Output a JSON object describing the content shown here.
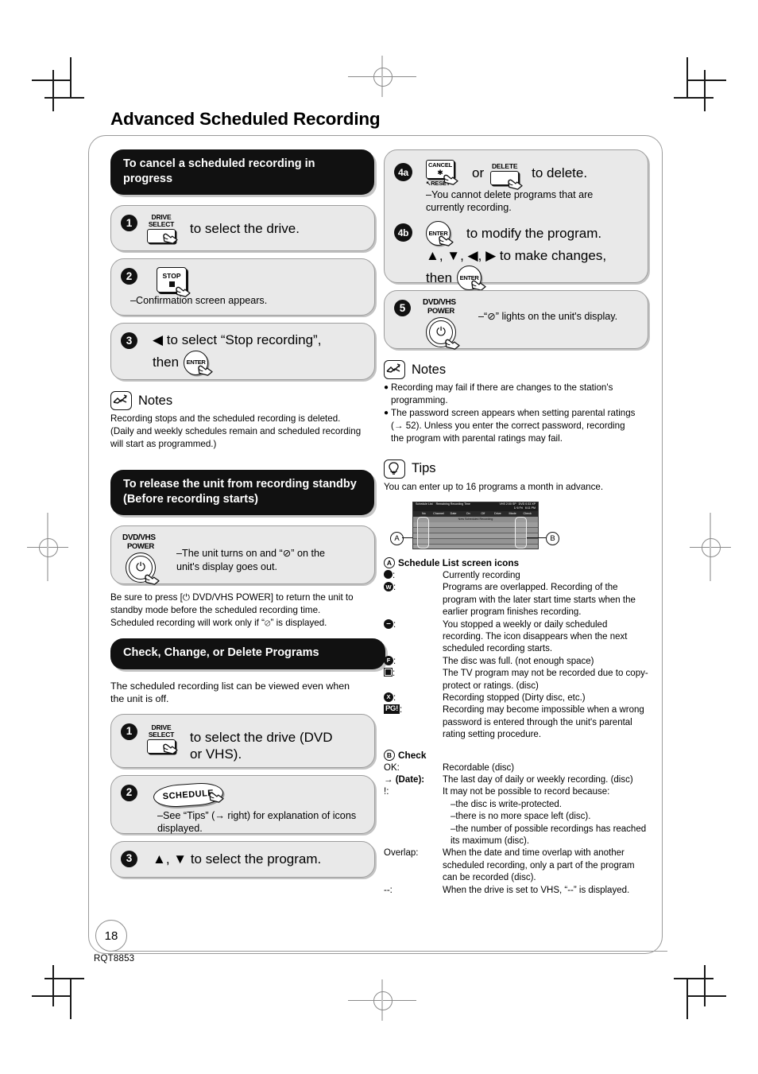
{
  "page": {
    "title": "Advanced Scheduled Recording",
    "number": "18",
    "doc_code": "RQT8853"
  },
  "left": {
    "section1": {
      "banner": "To cancel a scheduled recording in progress",
      "steps": [
        {
          "num": "1",
          "key_label_top": "DRIVE\nSELECT",
          "text": "to select the drive."
        },
        {
          "num": "2",
          "key_label": "STOP",
          "sub": "–Confirmation screen appears."
        },
        {
          "num": "3",
          "text_line1": "◀ to select “Stop recording”,",
          "text_line2": "then",
          "key": "ENTER"
        }
      ],
      "notes": {
        "label": "Notes",
        "body": "Recording stops and the scheduled recording is deleted. (Daily and weekly schedules remain and scheduled recording will start as programmed.)"
      }
    },
    "section2": {
      "banner": "To release the unit from recording standby\n(Before recording starts)",
      "power_key": {
        "line1": "DVD/VHS",
        "line2": "POWER",
        "glyph": "⏻"
      },
      "power_note": "–The unit turns on and “⊘” on the unit's display goes out.",
      "paragraph": "Be sure to press [⏻ DVD/VHS POWER] to return the unit to standby mode before the scheduled recording time. Scheduled recording will work only if “⊘” is displayed."
    },
    "section3": {
      "banner": "Check, Change, or Delete Programs",
      "paragraph": "The scheduled recording list can be viewed even when the unit is off.",
      "steps": [
        {
          "num": "1",
          "key_label_top": "DRIVE\nSELECT",
          "text": "to select the drive (DVD or VHS)."
        },
        {
          "num": "2",
          "key_label": "SCHEDULE",
          "sub": "–See “Tips” (→ right) for explanation of icons displayed."
        },
        {
          "num": "3",
          "text": "▲, ▼ to select the program."
        }
      ]
    }
  },
  "right": {
    "steps": [
      {
        "num": "4a",
        "key_cancel": "CANCEL",
        "key_cancel_star": "✱",
        "key_reset": "↖RESET",
        "conj": "or",
        "key_delete_top": "DELETE",
        "text": "to delete.",
        "sub": "–You cannot delete programs that are currently recording."
      },
      {
        "num": "4b",
        "key": "ENTER",
        "line1": "to modify the program.",
        "line2": "▲, ▼, ◀, ▶ to make changes,",
        "line3": "then",
        "key2": "ENTER"
      },
      {
        "num": "5",
        "power_key": {
          "line1": "DVD/VHS",
          "line2": "POWER",
          "glyph": "⏻"
        },
        "text": "–“⊘” lights on the unit's display."
      }
    ],
    "notes": {
      "label": "Notes",
      "items": [
        "Recording may fail if there are changes to the station's programming.",
        "The password screen appears when setting parental ratings (→ 52). Unless you enter the correct password, recording the program with parental ratings may fail."
      ]
    },
    "tips": {
      "label": "Tips",
      "intro": "You can enter up to 16 programs a month in advance.",
      "screen": {
        "title": "Schedule List",
        "remaining_label": "Remaining Recording Time",
        "vhs": "VHS  2:00 SP",
        "dvd": "DVD  0:33 XP",
        "date": "1/ 6 Fri",
        "time": "6:11 PM",
        "columns": [
          "No",
          "Channel",
          "Date",
          "On",
          "Off",
          "Drive",
          "Mode",
          "Check"
        ],
        "new_row": "New Scheduled Recording"
      },
      "marker_a": "A",
      "marker_b": "B",
      "icons_title": "Schedule List screen icons",
      "icons": [
        {
          "icon": "record-dot",
          "glyph": "",
          "desc": "Currently recording"
        },
        {
          "icon": "overlap-w",
          "glyph": "W",
          "desc": "Programs are overlapped. Recording of the program with the later start time starts when the earlier program finishes recording."
        },
        {
          "icon": "stopped-minus",
          "glyph": "–",
          "desc": "You stopped a weekly or daily scheduled recording. The icon disappears when the next scheduled recording starts."
        },
        {
          "icon": "disc-full-f",
          "glyph": "F",
          "desc": "The disc was full. (not enough space)"
        },
        {
          "icon": "copy-protect",
          "glyph": "",
          "desc": "The TV program may not be recorded due to copy-protect or ratings. (disc)"
        },
        {
          "icon": "stopped-x",
          "glyph": "X",
          "desc": "Recording stopped (Dirty disc, etc.)"
        },
        {
          "icon": "parental-pg",
          "glyph": "PG!",
          "desc": "Recording may become impossible when a wrong password is entered through the unit's parental rating setting procedure."
        }
      ],
      "check_title": "Check",
      "check_rows": [
        {
          "key": "OK:",
          "desc": "Recordable (disc)"
        },
        {
          "key": "→ (Date):",
          "desc": "The last day of daily or weekly recording. (disc)"
        },
        {
          "key": "!:",
          "desc": "It may not be possible to record because:",
          "subs": [
            "–the disc is write-protected.",
            "–there is no more space left (disc).",
            "–the number of possible recordings has reached its maximum (disc)."
          ]
        },
        {
          "key": "Overlap:",
          "desc": "When the date and time overlap with another scheduled recording, only a part of the program can be recorded (disc)."
        },
        {
          "key": "--:",
          "desc": "When the drive is set to VHS, “--” is displayed."
        }
      ]
    }
  }
}
